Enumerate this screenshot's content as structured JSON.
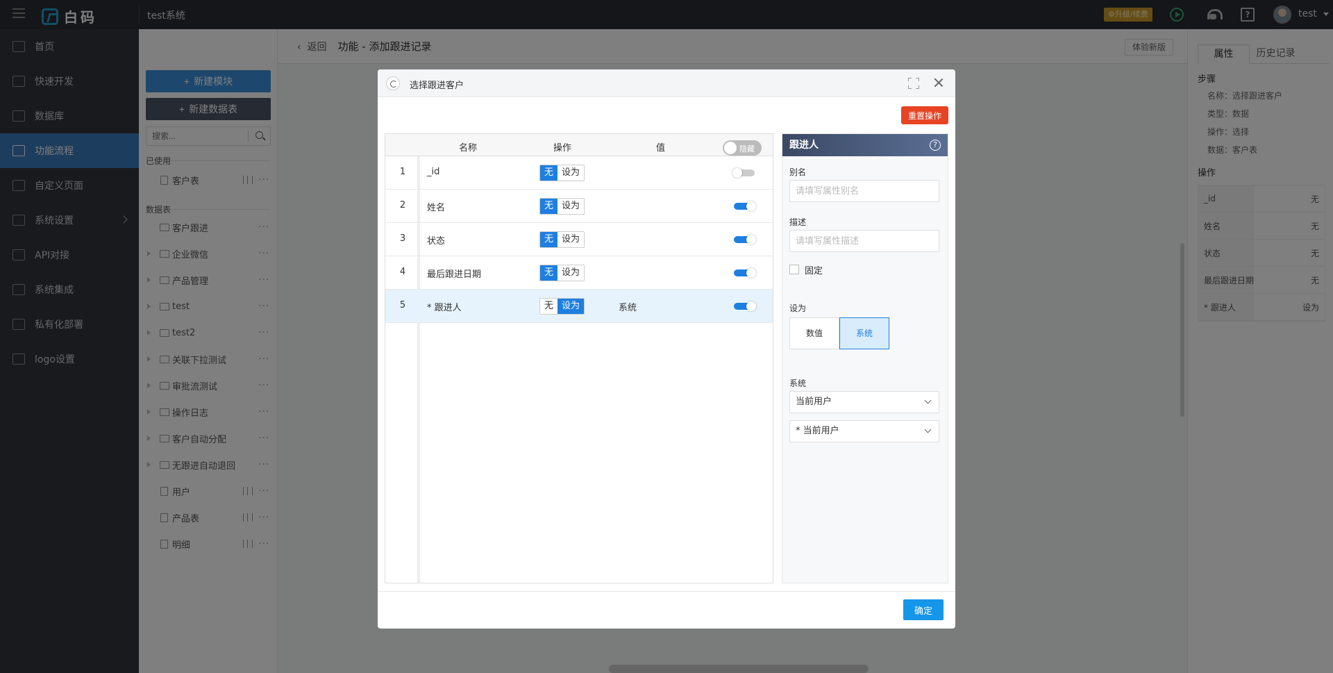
{
  "topbar": {
    "logo_text": "白码",
    "system_name": "test系统",
    "upgrade_label": "⚙升级/续费",
    "user_name": "test"
  },
  "leftnav": {
    "items": [
      {
        "label": "首页",
        "icon": "home-icon"
      },
      {
        "label": "快速开发",
        "icon": "cube-icon"
      },
      {
        "label": "数据库",
        "icon": "database-icon"
      },
      {
        "label": "功能流程",
        "icon": "flow-icon",
        "active": true
      },
      {
        "label": "自定义页面",
        "icon": "page-icon"
      },
      {
        "label": "系统设置",
        "icon": "settings-icon"
      },
      {
        "label": "API对接",
        "icon": "api-icon"
      },
      {
        "label": "系统集成",
        "icon": "layers-icon"
      },
      {
        "label": "私有化部署",
        "icon": "lock-icon"
      },
      {
        "label": "logo设置",
        "icon": "logo-icon"
      }
    ]
  },
  "subpanel": {
    "new_module": "新建模块",
    "new_table": "新建数据表",
    "search_placeholder": "搜索...",
    "used_label": "已使用",
    "tables_label": "数据表",
    "used_items": [
      "客户表"
    ],
    "tree": [
      {
        "label": "客户跟进",
        "type": "folder"
      },
      {
        "label": "企业微信",
        "type": "folder"
      },
      {
        "label": "产品管理",
        "type": "folder"
      },
      {
        "label": "test",
        "type": "folder"
      },
      {
        "label": "test2",
        "type": "folder"
      },
      {
        "label": "关联下拉测试",
        "type": "folder"
      },
      {
        "label": "审批流测试",
        "type": "folder"
      },
      {
        "label": "操作日志",
        "type": "folder"
      },
      {
        "label": "客户自动分配",
        "type": "folder"
      },
      {
        "label": "无跟进自动退回",
        "type": "folder"
      },
      {
        "label": "用户",
        "type": "file"
      },
      {
        "label": "产品表",
        "type": "file"
      },
      {
        "label": "明细",
        "type": "file"
      }
    ]
  },
  "main": {
    "back_label": "返回",
    "page_title": "功能 - 添加跟进记录",
    "experience_btn": "体验新版"
  },
  "rightpanel": {
    "tabs": [
      "属性",
      "历史记录"
    ],
    "steps_title": "步骤",
    "steps": [
      "名称：选择跟进客户",
      "类型：数据",
      "操作：选择",
      "数据：客户表"
    ],
    "ops_title": "操作",
    "ops": [
      {
        "k": "_id",
        "v": "无"
      },
      {
        "k": "姓名",
        "v": "无"
      },
      {
        "k": "状态",
        "v": "无"
      },
      {
        "k": "最后跟进日期",
        "v": "无"
      },
      {
        "k": "* 跟进人",
        "v": "设为"
      }
    ]
  },
  "modal": {
    "title": "选择跟进客户",
    "reset_label": "重置操作",
    "ok_label": "确定",
    "headers": {
      "name": "名称",
      "op": "操作",
      "value": "值",
      "hide_toggle": "隐藏"
    },
    "seg_none": "无",
    "seg_set": "设为",
    "rows": [
      {
        "idx": "1",
        "name": "_id",
        "value": "",
        "selected_op": "none",
        "toggle": "off"
      },
      {
        "idx": "2",
        "name": "姓名",
        "value": "",
        "selected_op": "none",
        "toggle": "on"
      },
      {
        "idx": "3",
        "name": "状态",
        "value": "",
        "selected_op": "none",
        "toggle": "on"
      },
      {
        "idx": "4",
        "name": "最后跟进日期",
        "value": "",
        "selected_op": "none",
        "toggle": "on"
      },
      {
        "idx": "5",
        "name": "* 跟进人",
        "value": "系统",
        "selected_op": "set",
        "toggle": "on"
      }
    ],
    "side": {
      "title": "跟进人",
      "alias_label": "别名",
      "alias_placeholder": "请填写属性别名",
      "desc_label": "描述",
      "desc_placeholder": "请填写属性描述",
      "fixed_label": "固定",
      "setas_label": "设为",
      "seg_options": [
        "数值",
        "系统"
      ],
      "seg_selected": "系统",
      "system_label": "系统",
      "select1": "当前用户",
      "select2": "* 当前用户"
    }
  },
  "colors": {
    "accent": "#1e7fe0",
    "reset": "#e64424",
    "nav_active": "#3a7bbd"
  }
}
